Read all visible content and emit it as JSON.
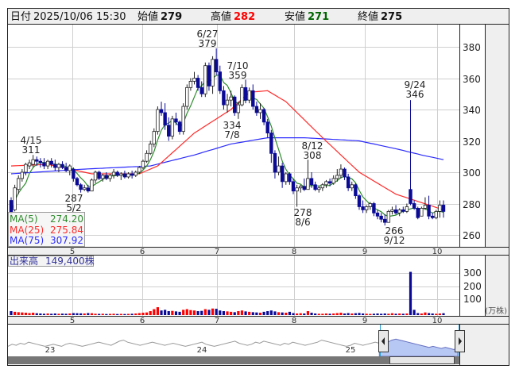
{
  "header": {
    "date_label": "日付",
    "datetime": "2025/10/06 15:30",
    "open_label": "始値",
    "open": "279",
    "high_label": "高値",
    "high": "282",
    "low_label": "安値",
    "low": "271",
    "close_label": "終値",
    "close": "275"
  },
  "colors": {
    "up_body": "#ffffff",
    "down_body": "#0a0a96",
    "ma5": "#2e8b2e",
    "ma25": "#ff2a2a",
    "ma75": "#2a2aff",
    "high_text": "#ff0000",
    "low_text": "#006400",
    "vol_up": "#ff0000",
    "vol_down": "#0a0a96",
    "vol_flat": "#999999"
  },
  "legend": [
    {
      "name": "MA(5)",
      "value": "274.20"
    },
    {
      "name": "MA(25)",
      "value": "275.84"
    },
    {
      "name": "MA(75)",
      "value": "307.92"
    }
  ],
  "volume_label": {
    "name": "出来高",
    "value": "149,400株"
  },
  "chart_data": [
    {
      "type": "candlestick",
      "title": "",
      "ylim": [
        250,
        392
      ],
      "yticks": [
        "380",
        "360",
        "340",
        "320",
        "300",
        "280",
        "260"
      ],
      "xticks": [
        "5",
        "6",
        "7",
        "8",
        "9",
        "10"
      ],
      "annotations": [
        {
          "date": "4/15",
          "value": "311",
          "kind": "high"
        },
        {
          "date": "5/2",
          "value": "287",
          "kind": "low"
        },
        {
          "date": "6/27",
          "value": "379",
          "kind": "high"
        },
        {
          "date": "7/8",
          "value": "334",
          "kind": "low"
        },
        {
          "date": "7/10",
          "value": "359",
          "kind": "high"
        },
        {
          "date": "8/6",
          "value": "278",
          "kind": "low"
        },
        {
          "date": "8/12",
          "value": "308",
          "kind": "high"
        },
        {
          "date": "9/12",
          "value": "266",
          "kind": "low"
        },
        {
          "date": "9/24",
          "value": "346",
          "kind": "high"
        }
      ],
      "ohlc": [
        [
          282,
          284,
          270,
          274
        ],
        [
          276,
          292,
          275,
          290
        ],
        [
          289,
          298,
          286,
          296
        ],
        [
          296,
          302,
          294,
          300
        ],
        [
          300,
          306,
          298,
          305
        ],
        [
          304,
          308,
          302,
          306
        ],
        [
          305,
          311,
          303,
          308
        ],
        [
          308,
          310,
          304,
          307
        ],
        [
          307,
          309,
          303,
          306
        ],
        [
          306,
          309,
          302,
          304
        ],
        [
          304,
          308,
          302,
          307
        ],
        [
          307,
          309,
          303,
          305
        ],
        [
          305,
          308,
          301,
          303
        ],
        [
          303,
          306,
          300,
          305
        ],
        [
          305,
          307,
          302,
          303
        ],
        [
          303,
          306,
          300,
          301
        ],
        [
          301,
          305,
          298,
          304
        ],
        [
          302,
          303,
          294,
          296
        ],
        [
          296,
          297,
          291,
          292
        ],
        [
          292,
          293,
          287,
          289
        ],
        [
          289,
          292,
          288,
          290
        ],
        [
          290,
          292,
          287,
          288
        ],
        [
          288,
          296,
          288,
          295
        ],
        [
          295,
          301,
          293,
          300
        ],
        [
          300,
          301,
          295,
          296
        ],
        [
          296,
          299,
          294,
          298
        ],
        [
          298,
          300,
          295,
          296
        ],
        [
          296,
          299,
          294,
          298
        ],
        [
          298,
          302,
          296,
          300
        ],
        [
          300,
          301,
          297,
          298
        ],
        [
          298,
          300,
          295,
          299
        ],
        [
          299,
          301,
          296,
          297
        ],
        [
          297,
          300,
          296,
          299
        ],
        [
          299,
          301,
          296,
          298
        ],
        [
          298,
          301,
          297,
          300
        ],
        [
          300,
          304,
          299,
          303
        ],
        [
          303,
          308,
          302,
          307
        ],
        [
          307,
          314,
          306,
          312
        ],
        [
          312,
          320,
          311,
          318
        ],
        [
          318,
          328,
          316,
          326
        ],
        [
          326,
          342,
          324,
          340
        ],
        [
          340,
          345,
          336,
          338
        ],
        [
          338,
          344,
          327,
          330
        ],
        [
          330,
          335,
          320,
          323
        ],
        [
          323,
          336,
          321,
          334
        ],
        [
          334,
          338,
          330,
          332
        ],
        [
          332,
          333,
          324,
          326
        ],
        [
          326,
          344,
          324,
          342
        ],
        [
          342,
          356,
          340,
          354
        ],
        [
          354,
          360,
          352,
          358
        ],
        [
          358,
          364,
          356,
          360
        ],
        [
          360,
          362,
          352,
          354
        ],
        [
          354,
          358,
          348,
          350
        ],
        [
          350,
          370,
          348,
          368
        ],
        [
          368,
          370,
          352,
          355
        ],
        [
          355,
          374,
          350,
          372
        ],
        [
          372,
          379,
          362,
          364
        ],
        [
          364,
          368,
          350,
          352
        ],
        [
          352,
          355,
          340,
          343
        ],
        [
          343,
          350,
          338,
          346
        ],
        [
          346,
          352,
          342,
          348
        ],
        [
          348,
          349,
          336,
          338
        ],
        [
          338,
          345,
          334,
          343
        ],
        [
          343,
          356,
          342,
          354
        ],
        [
          354,
          359,
          344,
          346
        ],
        [
          346,
          354,
          344,
          352
        ],
        [
          352,
          356,
          340,
          342
        ],
        [
          342,
          345,
          336,
          338
        ],
        [
          338,
          344,
          334,
          340
        ],
        [
          340,
          341,
          330,
          332
        ],
        [
          332,
          334,
          322,
          325
        ],
        [
          325,
          327,
          306,
          312
        ],
        [
          312,
          314,
          296,
          300
        ],
        [
          300,
          310,
          298,
          304
        ],
        [
          304,
          306,
          290,
          294
        ],
        [
          294,
          300,
          292,
          299
        ],
        [
          299,
          300,
          292,
          294
        ],
        [
          294,
          296,
          286,
          288
        ],
        [
          288,
          292,
          278,
          290
        ],
        [
          290,
          292,
          287,
          291
        ],
        [
          291,
          296,
          288,
          289
        ],
        [
          289,
          308,
          289,
          296
        ],
        [
          296,
          300,
          290,
          292
        ],
        [
          292,
          294,
          288,
          289
        ],
        [
          289,
          291,
          287,
          290
        ],
        [
          290,
          293,
          288,
          292
        ],
        [
          292,
          295,
          290,
          294
        ],
        [
          294,
          296,
          291,
          293
        ],
        [
          293,
          298,
          292,
          296
        ],
        [
          296,
          302,
          294,
          298
        ],
        [
          298,
          305,
          296,
          302
        ],
        [
          302,
          303,
          295,
          297
        ],
        [
          297,
          299,
          288,
          290
        ],
        [
          290,
          294,
          288,
          292
        ],
        [
          292,
          293,
          283,
          285
        ],
        [
          285,
          286,
          276,
          278
        ],
        [
          278,
          282,
          274,
          276
        ],
        [
          276,
          279,
          274,
          278
        ],
        [
          278,
          281,
          276,
          280
        ],
        [
          280,
          281,
          272,
          274
        ],
        [
          274,
          276,
          270,
          272
        ],
        [
          272,
          274,
          268,
          270
        ],
        [
          270,
          273,
          266,
          268
        ],
        [
          268,
          276,
          268,
          275
        ],
        [
          275,
          278,
          273,
          276
        ],
        [
          276,
          279,
          273,
          274
        ],
        [
          274,
          277,
          272,
          276
        ],
        [
          276,
          278,
          274,
          275
        ],
        [
          275,
          280,
          274,
          278
        ],
        [
          289,
          346,
          279,
          280
        ],
        [
          280,
          282,
          276,
          277
        ],
        [
          277,
          278,
          270,
          271
        ],
        [
          272,
          278,
          272,
          277
        ],
        [
          277,
          284,
          276,
          279
        ],
        [
          279,
          285,
          270,
          272
        ],
        [
          272,
          274,
          270,
          271
        ],
        [
          271,
          276,
          270,
          275
        ],
        [
          275,
          282,
          271,
          279
        ],
        [
          279,
          282,
          271,
          275
        ]
      ],
      "ma25_points": [
        [
          0,
          304
        ],
        [
          10,
          305
        ],
        [
          18,
          301
        ],
        [
          22,
          299
        ],
        [
          35,
          299
        ],
        [
          40,
          304
        ],
        [
          50,
          325
        ],
        [
          60,
          340
        ],
        [
          65,
          351
        ],
        [
          70,
          352
        ],
        [
          75,
          345
        ],
        [
          85,
          322
        ],
        [
          95,
          300
        ],
        [
          105,
          286
        ],
        [
          118,
          276
        ]
      ],
      "ma75_points": [
        [
          0,
          299
        ],
        [
          20,
          302
        ],
        [
          38,
          304
        ],
        [
          50,
          311
        ],
        [
          60,
          318
        ],
        [
          70,
          322
        ],
        [
          80,
          322
        ],
        [
          95,
          320
        ],
        [
          105,
          315
        ],
        [
          112,
          311
        ],
        [
          118,
          308
        ]
      ]
    },
    {
      "type": "bar",
      "title": "出来高",
      "ylabel": "(万株)",
      "yticks": [
        "300",
        "200",
        "100"
      ],
      "xticks": [
        "5",
        "6",
        "7",
        "8",
        "9",
        "10"
      ],
      "values": [
        30,
        25,
        22,
        20,
        18,
        15,
        18,
        14,
        12,
        10,
        12,
        10,
        12,
        10,
        11,
        10,
        12,
        15,
        14,
        13,
        12,
        15,
        14,
        10,
        9,
        10,
        8,
        9,
        10,
        8,
        9,
        8,
        9,
        10,
        12,
        15,
        18,
        20,
        30,
        45,
        60,
        35,
        40,
        30,
        32,
        28,
        25,
        40,
        45,
        38,
        35,
        30,
        32,
        45,
        40,
        50,
        48,
        35,
        30,
        28,
        25,
        22,
        30,
        35,
        28,
        25,
        22,
        20,
        18,
        25,
        30,
        35,
        28,
        22,
        20,
        18,
        25,
        15,
        12,
        14,
        12,
        30,
        18,
        12,
        10,
        10,
        12,
        10,
        12,
        15,
        18,
        12,
        15,
        12,
        14,
        16,
        12,
        10,
        9,
        10,
        12,
        10,
        12,
        10,
        14,
        10,
        12,
        10,
        12,
        330,
        40,
        15,
        12,
        20,
        15,
        12,
        10,
        12,
        14
      ]
    }
  ],
  "navigator": {
    "labels": [
      "23",
      "24",
      "25"
    ],
    "series": [
      12,
      14,
      13,
      15,
      14,
      16,
      15,
      14,
      13,
      12,
      13,
      14,
      13,
      12,
      14,
      15,
      14,
      13,
      12,
      13,
      14,
      15,
      16,
      15,
      14,
      13,
      15,
      17,
      18,
      16,
      15,
      14,
      13,
      14,
      15,
      16,
      15,
      14,
      13,
      14,
      15,
      14,
      13,
      12,
      13,
      14,
      15,
      16,
      14,
      13,
      12,
      13,
      14,
      15,
      16,
      17,
      15,
      14,
      13,
      14,
      16,
      15,
      17,
      16,
      15,
      14,
      13,
      15,
      14,
      16,
      15,
      14,
      13,
      14,
      15,
      16,
      18,
      17,
      16,
      15,
      14,
      13,
      12,
      13,
      15,
      14,
      13,
      14,
      15,
      16,
      15,
      17,
      16,
      18,
      19,
      18,
      17,
      16,
      15,
      14,
      13,
      12,
      11,
      12,
      11,
      10,
      11,
      10,
      9,
      10
    ]
  }
}
